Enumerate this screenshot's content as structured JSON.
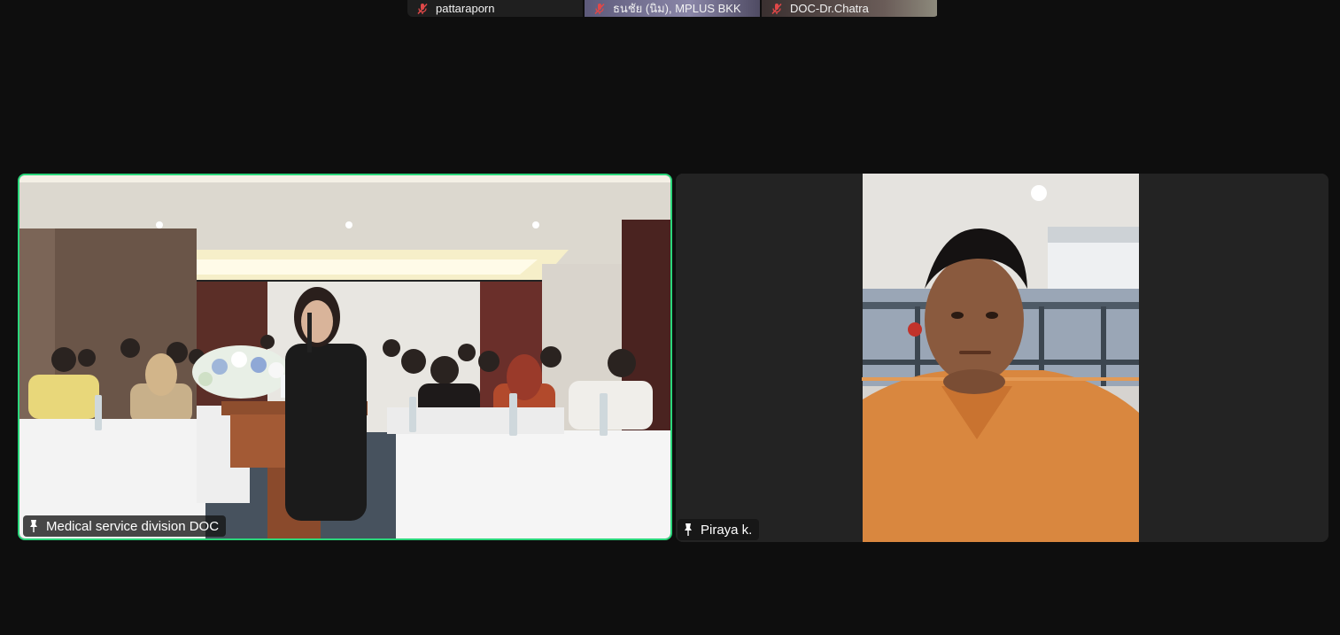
{
  "thumbnails": [
    {
      "name": "pattaraporn",
      "muted": true
    },
    {
      "name": "ธนชัย (นิม), MPLUS BKK",
      "muted": true
    },
    {
      "name": "DOC-Dr.Chatra",
      "muted": true
    }
  ],
  "tiles": [
    {
      "name": "Medical service division DOC",
      "pinned": true,
      "active_speaker": true
    },
    {
      "name": "Piraya k.",
      "pinned": true,
      "active_speaker": false
    }
  ],
  "colors": {
    "background": "#0e0e0e",
    "tile_bg": "#232323",
    "active_border": "#2bd67b",
    "muted_icon": "#e04848"
  },
  "icons": {
    "thumbnail_status": "muted-mic-icon",
    "tile_tag": "pin-icon"
  }
}
